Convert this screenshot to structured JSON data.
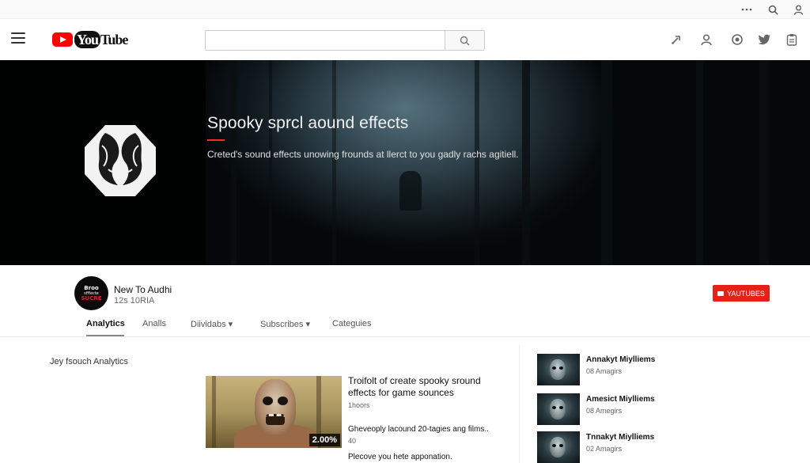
{
  "window": {
    "icons": [
      "more-icon",
      "search-icon",
      "account-icon"
    ]
  },
  "masthead": {
    "logo_text": "YouTube",
    "search": {
      "placeholder": "",
      "value": ""
    },
    "icons": [
      "upload-icon",
      "account-icon",
      "notifications-icon",
      "twitter-icon",
      "clipboard-icon"
    ]
  },
  "banner": {
    "title": "Spooky sprcl  aound effects",
    "description": "Creted's sound effects unowing frounds at llerct to you gadly rachs agitiell.",
    "accent_color": "#ff2a2a"
  },
  "channel": {
    "name": "New To Audhi",
    "subscribers": "12s 10RIA",
    "avatar_text": {
      "line1": "Broo",
      "line2": "sfffecte",
      "line3": "SUCRE"
    },
    "subscribe_label": "YAUTUBES",
    "subscribe_color": "#e62117",
    "tabs": [
      {
        "label": "Analytics",
        "active": true
      },
      {
        "label": "Analls",
        "active": false
      },
      {
        "label": "Diividabs ▾",
        "active": false
      },
      {
        "label": "Subscribes ▾",
        "active": false
      },
      {
        "label": "Categuies",
        "active": false
      }
    ]
  },
  "content": {
    "section_title": "Jey fsouch Analytics",
    "featured": {
      "title": "Troifolt of create spooky sround effects for game sounces",
      "meta": "1hoors",
      "duration": "2.00%",
      "description": "Gheveoply lacound 20-tagies ang films..",
      "count": "40",
      "note": "Plecove you hete apponation."
    },
    "sidebar": [
      {
        "title": "Annakyt Miylliems",
        "meta": "08 Amagirs"
      },
      {
        "title": "Amesict Miylliems",
        "meta": "08 Amegirs"
      },
      {
        "title": "Tnnakyt Miylliems",
        "meta": "02 Amagirs"
      }
    ]
  }
}
